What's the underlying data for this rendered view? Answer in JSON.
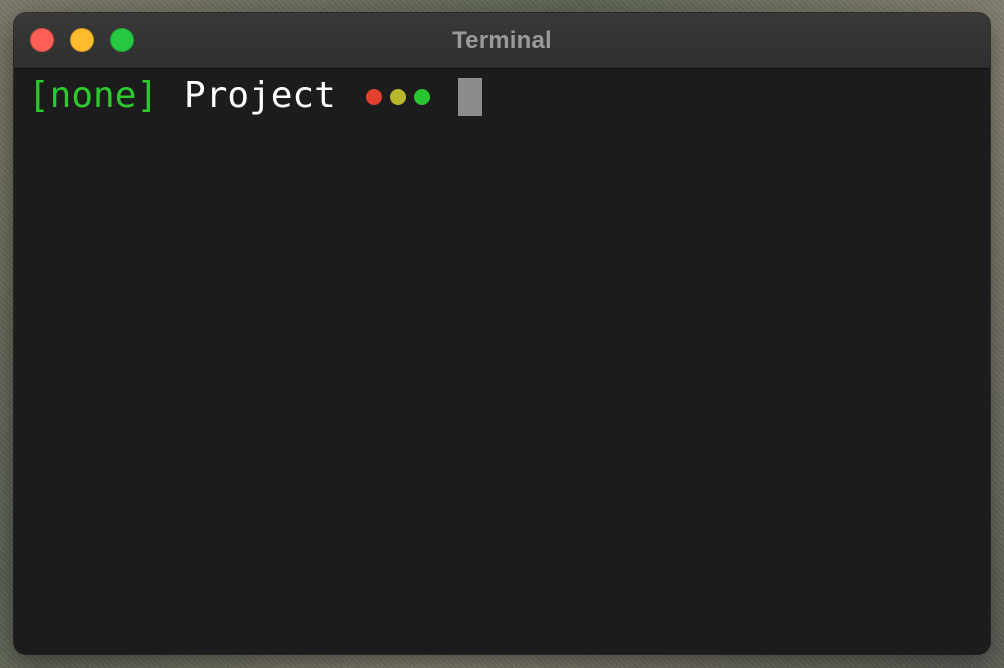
{
  "window": {
    "title": "Terminal"
  },
  "title_bar": {
    "controls": [
      {
        "name": "close-button",
        "color": "#ff5f57"
      },
      {
        "name": "minimize-button",
        "color": "#febc2e"
      },
      {
        "name": "zoom-button",
        "color": "#28c840"
      }
    ]
  },
  "terminal": {
    "environment": "[none]",
    "project": "Project",
    "status_dots": [
      {
        "name": "status-dot-red",
        "color": "#e2412f"
      },
      {
        "name": "status-dot-yellow",
        "color": "#b8b82d"
      },
      {
        "name": "status-dot-green",
        "color": "#29c531"
      }
    ],
    "cursor_icon": "block-cursor-icon"
  },
  "colors": {
    "terminal_background": "#1c1c1c",
    "prompt_environment": "#2ec92e",
    "prompt_project": "#ffffff",
    "cursor": "#8c8c8c"
  }
}
